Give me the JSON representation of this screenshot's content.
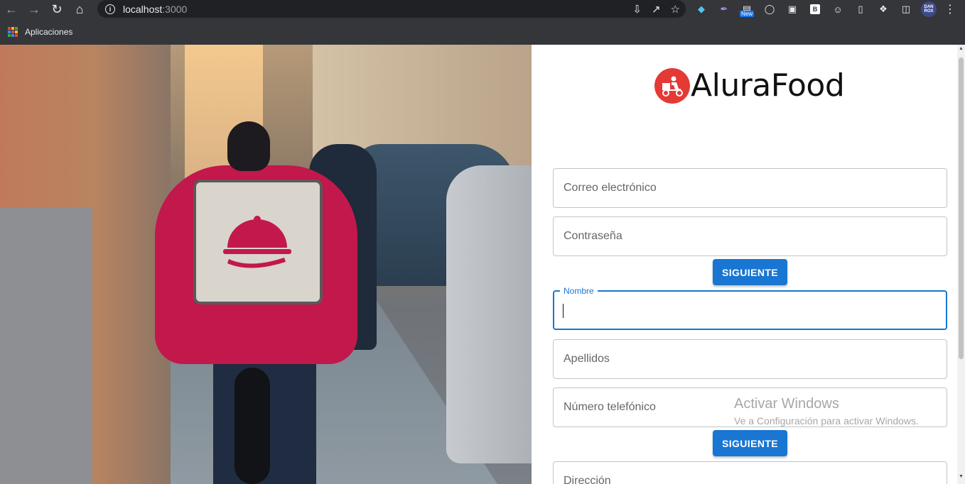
{
  "browser": {
    "url_host": "localhost",
    "url_port": ":3000",
    "new_badge": "New",
    "ext_b_label": "B",
    "avatar_text": "DAN ROX",
    "bookmarks_label": "Aplicaciones"
  },
  "brand": {
    "name": "AluraFood",
    "logo_color": "#e53935"
  },
  "form": {
    "email_placeholder": "Correo electrónico",
    "password_placeholder": "Contraseña",
    "next_button_1": "SIGUIENTE",
    "name_label": "Nombre",
    "lastname_placeholder": "Apellidos",
    "phone_placeholder": "Número telefónico",
    "next_button_2": "SIGUIENTE",
    "address_placeholder": "Dirección",
    "accent_color": "#1976d2"
  },
  "watermark": {
    "title": "Activar Windows",
    "subtitle": "Ve a Configuración para activar Windows."
  }
}
